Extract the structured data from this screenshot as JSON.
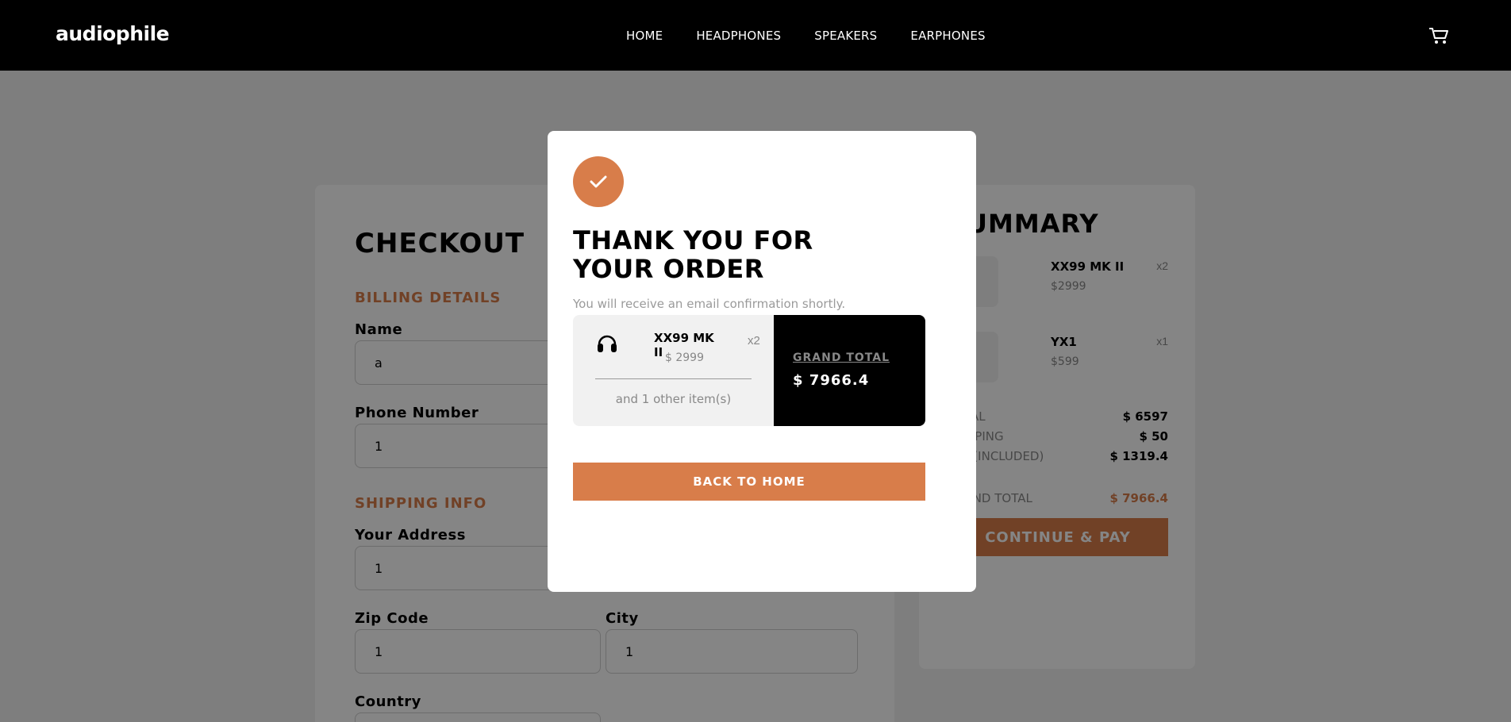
{
  "header": {
    "logo": "audiophile",
    "nav": [
      "HOME",
      "HEADPHONES",
      "SPEAKERS",
      "EARPHONES"
    ],
    "cart_icon": "cart-icon"
  },
  "checkout": {
    "title": "CHECKOUT",
    "billing_title": "BILLING DETAILS",
    "name_label": "Name",
    "name_value": "a",
    "phone_label": "Phone Number",
    "phone_value": "1",
    "shipping_title": "SHIPPING INFO",
    "address_label": "Your Address",
    "address_value": "1",
    "zip_label": "Zip Code",
    "zip_value": "1",
    "city_label": "City",
    "city_value": "1",
    "country_label": "Country"
  },
  "summary": {
    "title": "SUMMARY",
    "items": [
      {
        "name": "XX99 MK II",
        "price": "$2999",
        "qty": "x2"
      },
      {
        "name": "YX1",
        "price": "$599",
        "qty": "x1"
      }
    ],
    "rows": [
      {
        "label": "TOTAL",
        "value": "$ 6597"
      },
      {
        "label": "SHIPPING",
        "value": "$ 50"
      },
      {
        "label": "VAT (INCLUDED)",
        "value": "$ 1319.4"
      }
    ],
    "grand_total_label": "GRAND TOTAL",
    "grand_total_value": "$ 7966.4",
    "pay_button": "CONTINUE & PAY"
  },
  "modal": {
    "check_icon": "check-icon",
    "title": "THANK YOU FOR YOUR ORDER",
    "subtitle": "You will receive an email confirmation shortly.",
    "item": {
      "name": "XX99 MK II",
      "price": "$ 2999",
      "qty": "x2"
    },
    "more_items": "and 1 other item(s)",
    "grand_total_label": "GRAND TOTAL",
    "grand_total_value": "$ 7966.4",
    "back_button": "BACK TO HOME"
  },
  "colors": {
    "accent": "#d87d4a",
    "dark": "#000000",
    "muted": "#888888"
  }
}
